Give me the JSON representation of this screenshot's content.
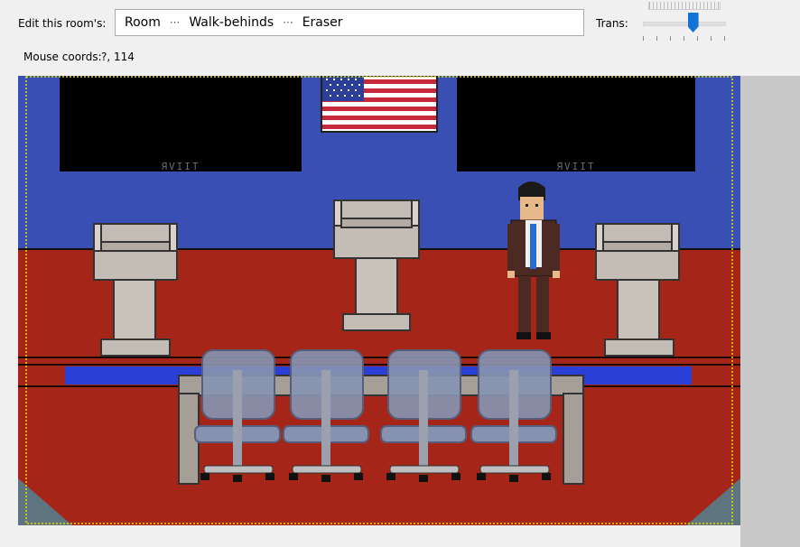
{
  "toolbar": {
    "edit_label": "Edit this room's:",
    "crumbs": [
      "Room",
      "Walk-behinds",
      "Eraser"
    ],
    "separator": "···",
    "trans_label": "Trans:",
    "trans_level_fraction": 0.62,
    "mouse_coords_label": "Mouse coords:",
    "mouse_coords_value": "?, 114"
  },
  "room": {
    "monitor_text": "ЯVIIT",
    "colors": {
      "wall": "#3a4fb3",
      "floor": "#a52619",
      "screen": "#000000",
      "podium": "#c4bdb5",
      "chair": "#8792b0",
      "table": "#a59f98",
      "stripe": "#2a3fd6",
      "highlight": "#e6e000"
    }
  }
}
